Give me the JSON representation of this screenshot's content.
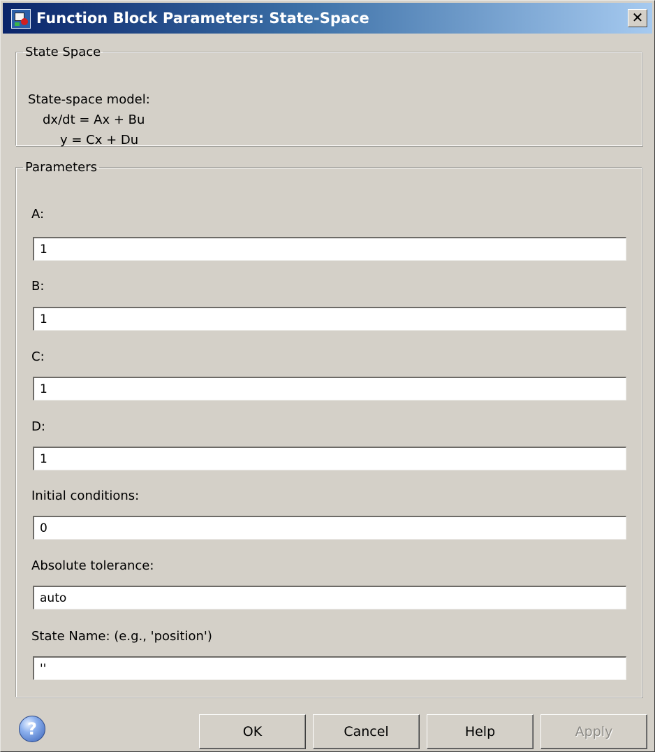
{
  "window": {
    "title": "Function Block Parameters: State-Space",
    "close_label": "✕"
  },
  "state_space": {
    "legend": "State Space",
    "lines": [
      "State-space model:",
      "dx/dt = Ax + Bu",
      "y = Cx + Du"
    ]
  },
  "parameters": {
    "legend": "Parameters",
    "fields": [
      {
        "label": "A:",
        "value": "1"
      },
      {
        "label": "B:",
        "value": "1"
      },
      {
        "label": "C:",
        "value": "1"
      },
      {
        "label": "D:",
        "value": "1"
      },
      {
        "label": "Initial conditions:",
        "value": "0"
      },
      {
        "label": "Absolute tolerance:",
        "value": "auto"
      },
      {
        "label": "State Name: (e.g., 'position')",
        "value": "''"
      }
    ]
  },
  "buttons": {
    "help_icon": "?",
    "ok": "OK",
    "cancel": "Cancel",
    "help": "Help",
    "apply": "Apply",
    "apply_enabled": false
  },
  "icons": {
    "window_icon": "simulink-block-icon",
    "help_icon": "help-question-icon",
    "close_icon": "close-icon"
  },
  "colors": {
    "dialog_bg": "#d4d0c8",
    "title_gradient_start": "#0a246a",
    "title_gradient_end": "#a6caf0"
  }
}
